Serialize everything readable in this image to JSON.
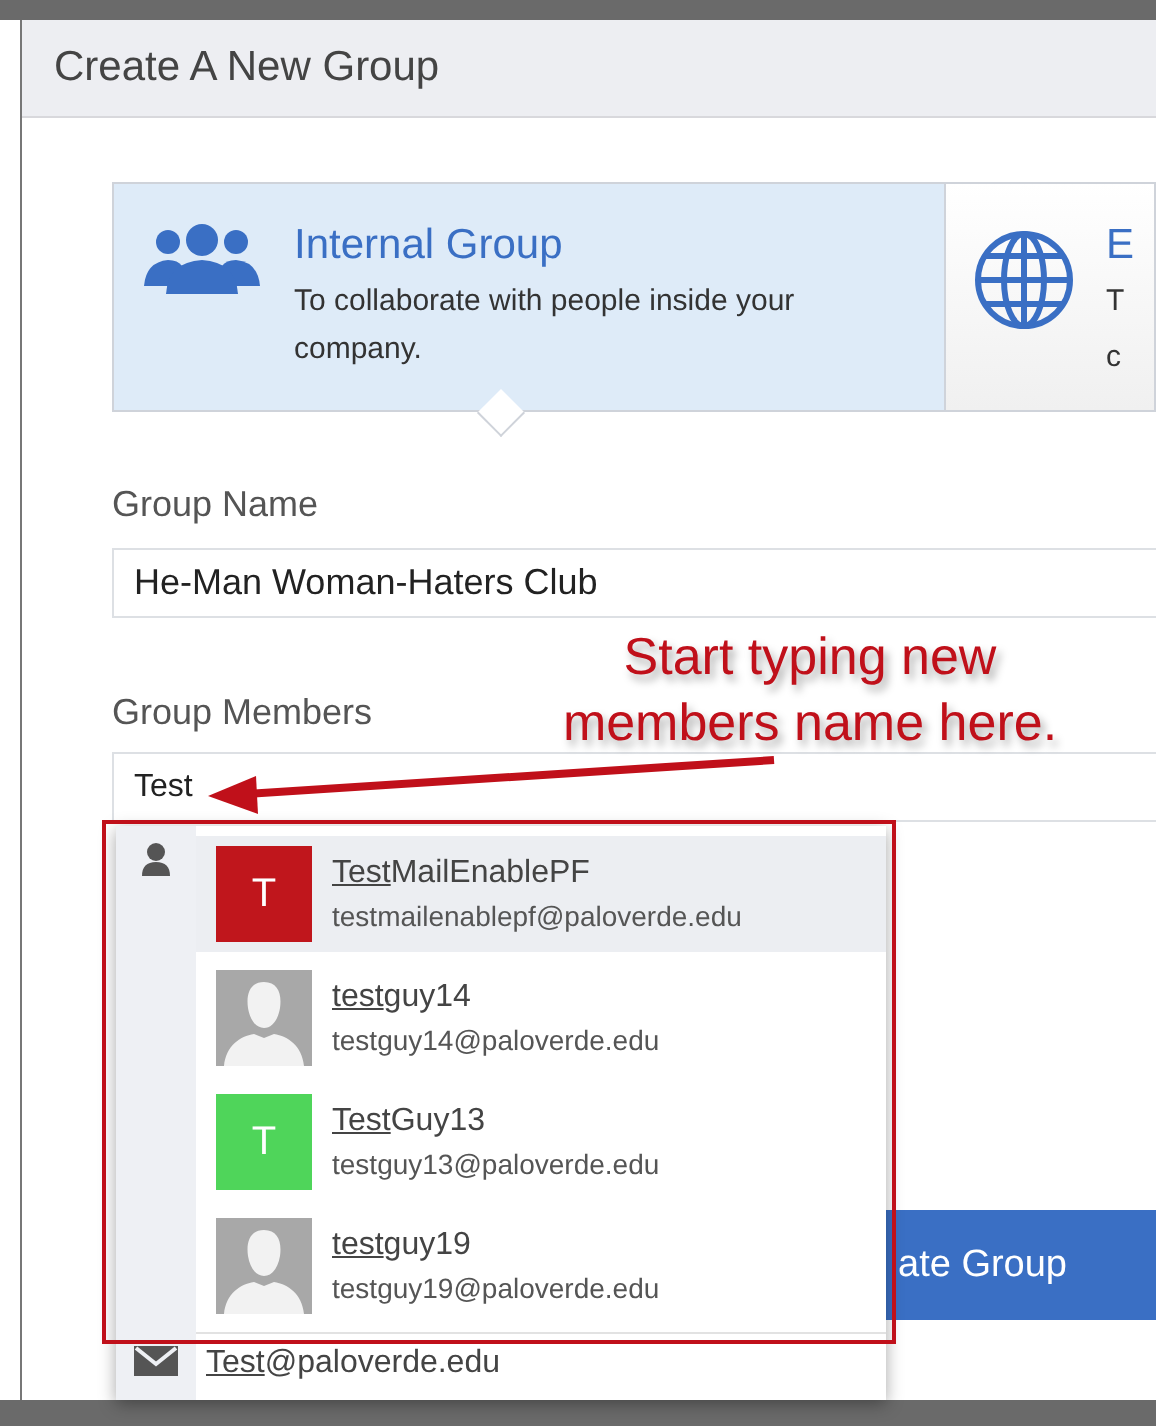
{
  "dialog": {
    "title": "Create A New Group"
  },
  "group_types": [
    {
      "kind": "internal",
      "title": "Internal Group",
      "description": "To collaborate with people inside your company.",
      "selected": true
    },
    {
      "kind": "external",
      "title": "E",
      "description_lines": [
        "T",
        "c"
      ],
      "selected": false
    }
  ],
  "group_name": {
    "label": "Group Name",
    "value": "He-Man Woman-Haters Club"
  },
  "group_members": {
    "label": "Group Members",
    "value": "Test"
  },
  "annotation": {
    "lines": [
      "Start typing new",
      "members name here."
    ]
  },
  "create_button": {
    "label": "ate Group"
  },
  "suggestions": [
    {
      "match": "Test",
      "rest": "MailEnablePF",
      "email": "testmailenablepf@paloverde.edu",
      "avatar": {
        "kind": "letter",
        "letter": "T",
        "color": "#c0161c"
      },
      "selected": true
    },
    {
      "match": "test",
      "rest": "guy14",
      "email": "testguy14@paloverde.edu",
      "avatar": {
        "kind": "silhouette"
      },
      "selected": false
    },
    {
      "match": "Test",
      "rest": "Guy13",
      "email": "testguy13@paloverde.edu",
      "avatar": {
        "kind": "letter",
        "letter": "T",
        "color": "#4fd55a"
      },
      "selected": false
    },
    {
      "match": "test",
      "rest": "guy19",
      "email": "testguy19@paloverde.edu",
      "avatar": {
        "kind": "silhouette"
      },
      "selected": false
    }
  ],
  "email_suggestion": {
    "match": "Test",
    "rest": "@paloverde.edu"
  }
}
